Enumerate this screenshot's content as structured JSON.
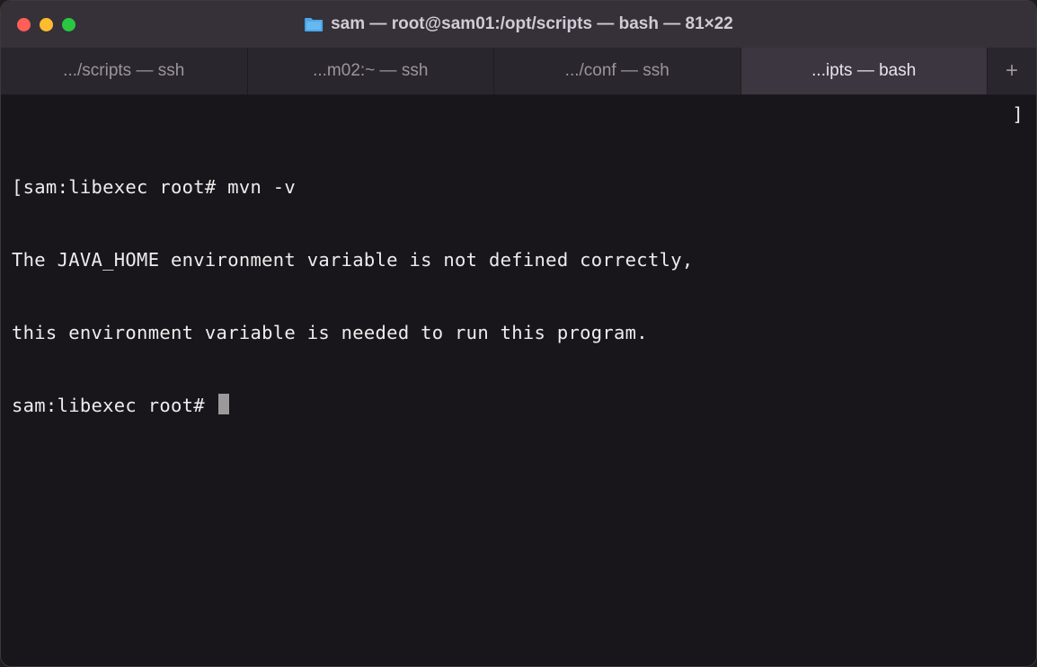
{
  "titlebar": {
    "title": "sam — root@sam01:/opt/scripts — bash — 81×22",
    "folder_icon": "folder-icon"
  },
  "tabs": [
    {
      "label": ".../scripts — ssh",
      "active": false
    },
    {
      "label": "...m02:~ — ssh",
      "active": false
    },
    {
      "label": ".../conf — ssh",
      "active": false
    },
    {
      "label": "...ipts — bash",
      "active": true
    }
  ],
  "tab_add_label": "+",
  "terminal": {
    "lines": [
      "[sam:libexec root# mvn -v",
      "The JAVA_HOME environment variable is not defined correctly,",
      "this environment variable is needed to run this program.",
      "sam:libexec root# "
    ],
    "right_bracket": "]"
  }
}
